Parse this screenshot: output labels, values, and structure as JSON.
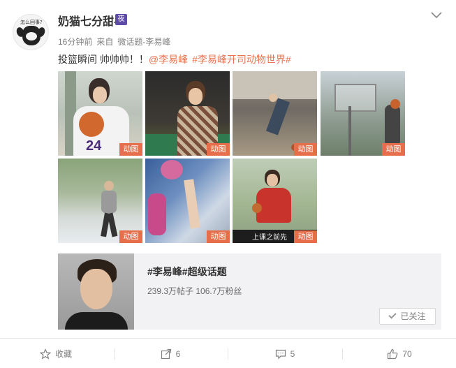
{
  "post": {
    "avatar_text": "怎么回事?",
    "username": "奶猫七分甜-",
    "vip_badge": "夜",
    "time": "16分钟前",
    "source_prefix": "来自",
    "source": "微话题-李易峰",
    "text_plain": "投篮瞬间   帅帅帅！！",
    "mention": "@李易峰",
    "hashtag": "#李易峰开司动物世界#"
  },
  "gallery": {
    "badge_label": "动图",
    "images": [
      {
        "name": "basketball-jersey-photo",
        "desc": "man holding basketball in purple jersey 24"
      },
      {
        "name": "sweater-photo",
        "desc": "man in patterned sweater"
      },
      {
        "name": "court-dribble-photo",
        "desc": "player dribbling on indoor court"
      },
      {
        "name": "outdoor-hoop-photo",
        "desc": "outdoor basketball hoop"
      },
      {
        "name": "outdoor-court-photo",
        "desc": "player on outdoor court"
      },
      {
        "name": "shooting-arm-photo",
        "desc": "arm shooting ball"
      },
      {
        "name": "red-shirt-photo",
        "desc": "man in red shirt with ball"
      }
    ],
    "tv_caption": "上课之前先"
  },
  "topic": {
    "title": "#李易峰#超级话题",
    "stats": "239.3万帖子 106.7万粉丝",
    "follow_label": "已关注"
  },
  "actions": {
    "favorite": "收藏",
    "repost": "6",
    "comment": "5",
    "like": "70"
  },
  "colors": {
    "link": "#eb7350",
    "gif_badge": "#e66e4a",
    "topic_bg": "#f2f2f5",
    "vip": "#5e4ba8"
  }
}
